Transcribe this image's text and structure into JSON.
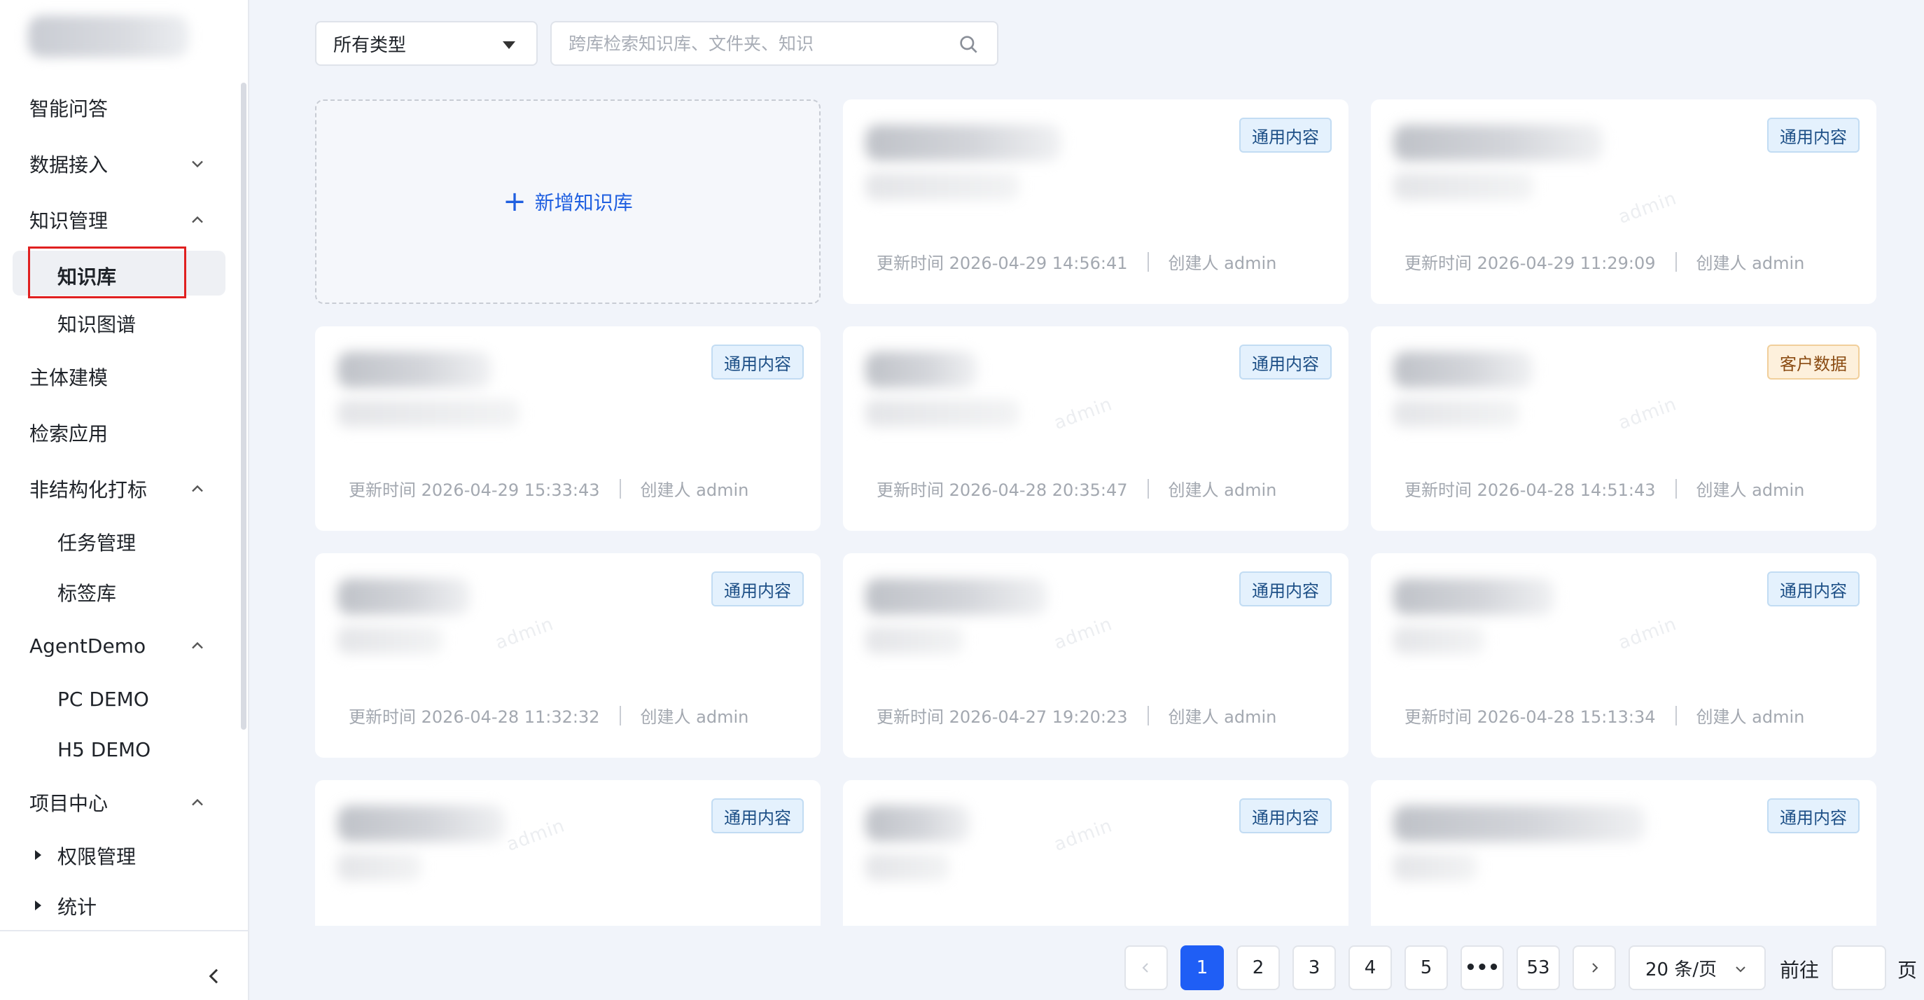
{
  "sidebar": {
    "items": [
      {
        "label": "智能问答",
        "expandable": false
      },
      {
        "label": "数据接入",
        "expandable": true,
        "expanded": false
      },
      {
        "label": "知识管理",
        "expandable": true,
        "expanded": true
      },
      {
        "label": "知识库",
        "selected": true
      },
      {
        "label": "知识图谱"
      },
      {
        "label": "主体建模"
      },
      {
        "label": "检索应用"
      },
      {
        "label": "非结构化打标",
        "expandable": true,
        "expanded": true
      },
      {
        "label": "任务管理"
      },
      {
        "label": "标签库"
      },
      {
        "label": "AgentDemo",
        "expandable": true,
        "expanded": true
      },
      {
        "label": "PC DEMO"
      },
      {
        "label": "H5 DEMO"
      },
      {
        "label": "项目中心",
        "expandable": true,
        "expanded": true
      },
      {
        "label": "权限管理"
      },
      {
        "label": "统计"
      }
    ]
  },
  "toolbar": {
    "type_select": "所有类型",
    "search_placeholder": "跨库检索知识库、文件夹、知识"
  },
  "add_card": {
    "label": "新增知识库"
  },
  "cards": [
    {
      "tag": "通用内容",
      "tag_color": "#1d4f86",
      "updated": "更新时间 2026-04-29 14:56:41",
      "creator": "创建人 admin"
    },
    {
      "tag": "通用内容",
      "tag_color": "#1d4f86",
      "updated": "更新时间 2026-04-29 11:29:09",
      "creator": "创建人 admin"
    },
    {
      "tag": "通用内容",
      "tag_color": "#1d4f86",
      "updated": "更新时间 2026-04-29 15:33:43",
      "creator": "创建人 admin"
    },
    {
      "tag": "通用内容",
      "tag_color": "#1d4f86",
      "updated": "更新时间 2026-04-28 20:35:47",
      "creator": "创建人 admin"
    },
    {
      "tag": "客户数据",
      "tag_color": "#8a4b12",
      "updated": "更新时间 2026-04-28 14:51:43",
      "creator": "创建人 admin"
    },
    {
      "tag": "通用内容",
      "tag_color": "#1d4f86",
      "updated": "更新时间 2026-04-28 11:32:32",
      "creator": "创建人 admin"
    },
    {
      "tag": "通用内容",
      "tag_color": "#1d4f86",
      "updated": "更新时间 2026-04-27 19:20:23",
      "creator": "创建人 admin"
    },
    {
      "tag": "通用内容",
      "tag_color": "#1d4f86",
      "updated": "更新时间 2026-04-28 15:13:34",
      "creator": "创建人 admin"
    },
    {
      "tag": "通用内容",
      "tag_color": "#1d4f86",
      "updated": "",
      "creator": ""
    },
    {
      "tag": "通用内容",
      "tag_color": "#1d4f86",
      "updated": "",
      "creator": ""
    },
    {
      "tag": "通用内容",
      "tag_color": "#1d4f86",
      "updated": "",
      "creator": ""
    }
  ],
  "watermark": "admin",
  "pagination": {
    "pages": [
      "1",
      "2",
      "3",
      "4",
      "5",
      "•••",
      "53"
    ],
    "current": "1",
    "page_size": "20 条/页",
    "goto_label": "前往",
    "goto_value": "",
    "page_unit": "页"
  },
  "colors": {
    "accent": "#1f5ef5",
    "tag_blue_bg": "#e4f1fd",
    "tag_orange_bg": "#fdf0dc",
    "highlight": "#e02020"
  }
}
